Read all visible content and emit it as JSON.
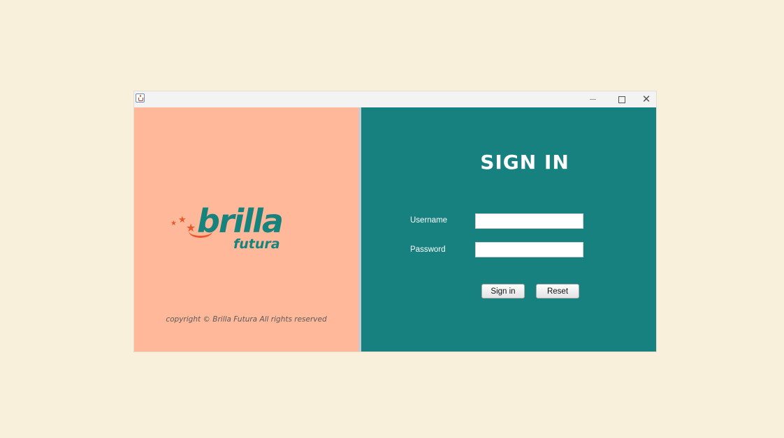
{
  "window": {
    "titlebar": {
      "title": "",
      "icon": "java-cup-icon",
      "controls": [
        "minimize",
        "maximize",
        "close"
      ],
      "close_glyph": "✕"
    }
  },
  "left_panel": {
    "background": "#ffb99a",
    "logo": {
      "brand": "brilla",
      "sub": "futura",
      "brand_color": "#17837d",
      "accent_color": "#e8582c"
    },
    "copyright": "copyright © Brilla Futura All rights reserved"
  },
  "right_panel": {
    "background": "#16817e",
    "title": "SIGN IN",
    "username_label": "Username",
    "username_value": "",
    "password_label": "Password",
    "password_value": "",
    "signin_button": "Sign in",
    "reset_button": "Reset"
  }
}
